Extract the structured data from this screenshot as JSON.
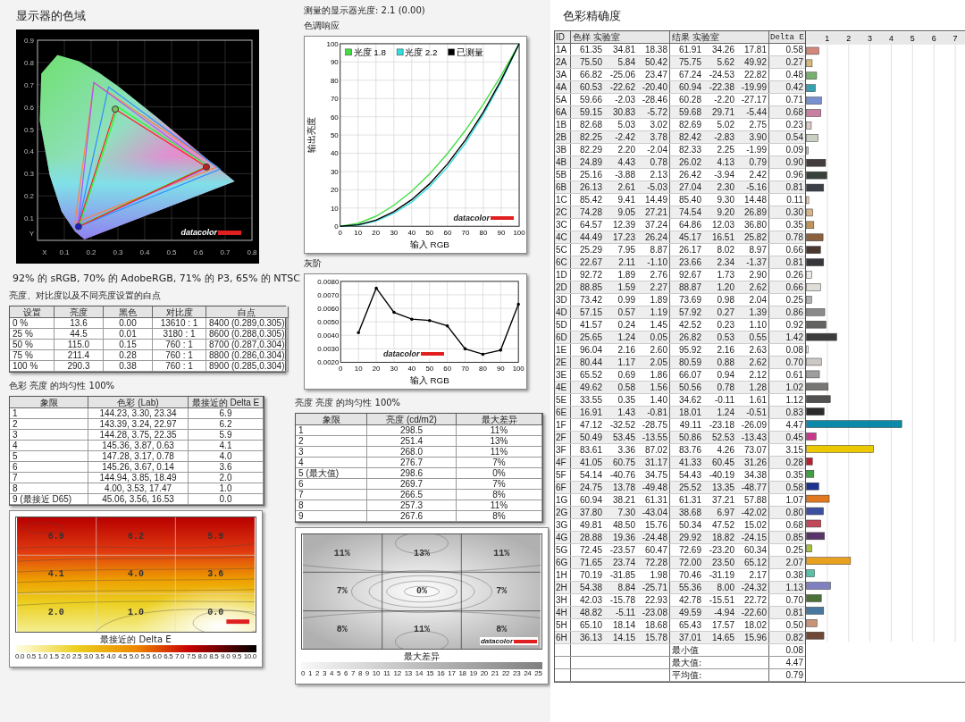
{
  "gamut": {
    "title": "显示器的色域",
    "x_ticks": [
      "X",
      "0.1",
      "0.2",
      "0.3",
      "0.4",
      "0.5",
      "0.6",
      "0.7",
      "0.8"
    ],
    "y_ticks": [
      "0.9",
      "0.8",
      "0.7",
      "0.6",
      "0.5",
      "0.4",
      "0.3",
      "0.2",
      "0.1",
      "Y"
    ],
    "brand": "datacolor",
    "summary": "92% 的 sRGB, 70% 的 AdobeRGB, 71% 的 P3, 65% 的 NTSC"
  },
  "brightness_table": {
    "title": "亮度、对比度以及不同亮度设置的白点",
    "columns": [
      "设置",
      "亮度",
      "黑色",
      "对比度",
      "白点"
    ],
    "rows": [
      [
        "0 %",
        "13.6",
        "0.00",
        "13610 : 1",
        "8400 (0.289,0.305)"
      ],
      [
        "25 %",
        "44.5",
        "0.01",
        "3180 : 1",
        "8600 (0.288,0.305)"
      ],
      [
        "50 %",
        "115.0",
        "0.15",
        "760 : 1",
        "8700 (0.287,0.304)"
      ],
      [
        "75 %",
        "211.4",
        "0.28",
        "760 : 1",
        "8800 (0.286,0.304)"
      ],
      [
        "100 %",
        "290.3",
        "0.38",
        "760 : 1",
        "8900 (0.285,0.304)"
      ]
    ]
  },
  "color_uniformity": {
    "title": "色彩 亮度 的均匀性 100%",
    "columns": [
      "象限",
      "色彩 (Lab)",
      "最接近的 Delta E"
    ],
    "rows": [
      [
        "1",
        "144.23, 3.30, 23.34",
        "6.9"
      ],
      [
        "2",
        "143.39, 3.24, 22.97",
        "6.2"
      ],
      [
        "3",
        "144.28, 3.75, 22.35",
        "5.9"
      ],
      [
        "4",
        "145.36, 3.87, 0.63",
        "4.1"
      ],
      [
        "5",
        "147.28, 3.17, 0.78",
        "4.0"
      ],
      [
        "6",
        "145.26, 3.67, 0.14",
        "3.6"
      ],
      [
        "7",
        "144.94, 3.85, 18.49",
        "2.0"
      ],
      [
        "8",
        "4.00, 3.53, 17.47",
        "1.0"
      ],
      [
        "9 (最接近 D65)",
        "45.06, 3.56, 16.53",
        "0.0"
      ]
    ],
    "heatmap": {
      "kind": "delta_e",
      "values": [
        "6.9",
        "6.2",
        "5.9",
        "4.1",
        "4.0",
        "3.6",
        "2.0",
        "1.0",
        "0.0"
      ],
      "legend_title": "最接近的 Delta E",
      "legend_ticks": [
        "0.0",
        "0.5",
        "1.0",
        "1.5",
        "2.0",
        "2.5",
        "3.0",
        "3.5",
        "4.0",
        "4.5",
        "5.0",
        "5.5",
        "6.0",
        "6.5",
        "7.0",
        "7.5",
        "8.0",
        "8.5",
        "9.0",
        "9.5",
        "10.0"
      ]
    }
  },
  "gamma": {
    "measured": "测量的显示器光度: 2.1 (0.00)",
    "title": "色调响应",
    "brand": "datacolor",
    "chart_data": {
      "type": "line",
      "grid": true,
      "legend": "upper left",
      "xlabel": "输入 RGB",
      "ylabel": "输出亮度",
      "x": [
        0,
        10,
        20,
        30,
        40,
        50,
        60,
        70,
        80,
        90,
        100
      ],
      "xlim": [
        0,
        100
      ],
      "ylim": [
        0,
        100
      ],
      "xticks": [
        0,
        10,
        20,
        30,
        40,
        50,
        60,
        70,
        80,
        90,
        100
      ],
      "yticks": [
        0,
        10,
        20,
        30,
        40,
        50,
        60,
        70,
        80,
        90,
        100
      ],
      "series": [
        {
          "name": "光度 1.8",
          "color": "#44dd44",
          "values": [
            0,
            1.6,
            5.5,
            11.5,
            19.2,
            28.7,
            39.9,
            52.6,
            66.9,
            82.7,
            100
          ]
        },
        {
          "name": "光度 2.2",
          "color": "#33dddd",
          "values": [
            0,
            0.6,
            2.9,
            7.1,
            13.3,
            21.8,
            32.5,
            45.6,
            61.2,
            79.3,
            100
          ]
        },
        {
          "name": "已测量",
          "color": "#000000",
          "values": [
            0,
            0.8,
            3.4,
            8.0,
            14.6,
            23.3,
            34.2,
            47.3,
            62.6,
            80.2,
            100
          ]
        }
      ]
    }
  },
  "grayscale": {
    "title": "灰阶",
    "brand": "datacolor",
    "chart_data": {
      "type": "line",
      "grid": true,
      "xlabel": "输入 RGB",
      "x": [
        10,
        20,
        30,
        40,
        50,
        60,
        70,
        80,
        90,
        100
      ],
      "xlim": [
        0,
        100
      ],
      "ylim": [
        0.002,
        0.008
      ],
      "xticks": [
        0,
        10,
        20,
        30,
        40,
        50,
        60,
        70,
        80,
        90,
        100
      ],
      "yticks": [
        {
          "value": 0.002,
          "label": "0.0020"
        },
        {
          "value": 0.003,
          "label": "0.0030"
        },
        {
          "value": 0.004,
          "label": "0.0040"
        },
        {
          "value": 0.005,
          "label": "0.0050"
        },
        {
          "value": 0.006,
          "label": "0.0060"
        },
        {
          "value": 0.007,
          "label": "0.0070"
        },
        {
          "value": 0.008,
          "label": "0.0080"
        }
      ],
      "series": [
        {
          "color": "#000000",
          "values": [
            0.0042,
            0.0075,
            0.0057,
            0.0052,
            0.0051,
            0.0047,
            0.003,
            0.0026,
            0.0029,
            0.0063
          ]
        }
      ]
    }
  },
  "luminance_uniformity": {
    "title": "亮度 亮度 的均匀性 100%",
    "columns": [
      "象限",
      "亮度 (cd/m2)",
      "最大差异"
    ],
    "rows": [
      [
        "1",
        "298.5",
        "11%"
      ],
      [
        "2",
        "251.4",
        "13%"
      ],
      [
        "3",
        "268.0",
        "11%"
      ],
      [
        "4",
        "276.7",
        "7%"
      ],
      [
        "5 (最大值)",
        "298.6",
        "0%"
      ],
      [
        "6",
        "269.7",
        "7%"
      ],
      [
        "7",
        "266.5",
        "8%"
      ],
      [
        "8",
        "257.3",
        "11%"
      ],
      [
        "9",
        "267.6",
        "8%"
      ]
    ],
    "heatmap": {
      "kind": "luminance",
      "values": [
        "11%",
        "13%",
        "11%",
        "7%",
        "0%",
        "7%",
        "8%",
        "11%",
        "8%"
      ],
      "legend_title": "最大差异",
      "brand": "datacolor",
      "legend_ticks": [
        "0",
        "1",
        "2",
        "3",
        "4",
        "5",
        "6",
        "7",
        "8",
        "9",
        "10",
        "11",
        "12",
        "13",
        "14",
        "15",
        "16",
        "17",
        "18",
        "19",
        "20",
        "21",
        "22",
        "23",
        "24",
        "25"
      ]
    }
  },
  "accuracy": {
    "title": "色彩精确度",
    "columns": [
      "ID",
      "色样 实验室",
      "结果 实验室",
      "Delta E"
    ],
    "rows": [
      {
        "id": "1A",
        "sample": [
          "61.35",
          "34.81",
          "18.38"
        ],
        "result": [
          "61.91",
          "34.26",
          "17.81"
        ],
        "delta_e": "0.58",
        "color": "#d4887c"
      },
      {
        "id": "2A",
        "sample": [
          "75.50",
          "5.84",
          "50.42"
        ],
        "result": [
          "75.75",
          "5.62",
          "49.92"
        ],
        "delta_e": "0.27",
        "color": "#d8b878"
      },
      {
        "id": "3A",
        "sample": [
          "66.82",
          "-25.06",
          "23.47"
        ],
        "result": [
          "67.24",
          "-24.53",
          "22.82"
        ],
        "delta_e": "0.48",
        "color": "#78b070"
      },
      {
        "id": "4A",
        "sample": [
          "60.53",
          "-22.62",
          "-20.40"
        ],
        "result": [
          "60.94",
          "-22.38",
          "-19.99"
        ],
        "delta_e": "0.42",
        "color": "#3aa0b0"
      },
      {
        "id": "5A",
        "sample": [
          "59.66",
          "-2.03",
          "-28.46"
        ],
        "result": [
          "60.28",
          "-2.20",
          "-27.17"
        ],
        "delta_e": "0.71",
        "color": "#7890d0"
      },
      {
        "id": "6A",
        "sample": [
          "59.15",
          "30.83",
          "-5.72"
        ],
        "result": [
          "59.68",
          "29.71",
          "-5.44"
        ],
        "delta_e": "0.68",
        "color": "#c880a0"
      },
      {
        "id": "1B",
        "sample": [
          "82.68",
          "5.03",
          "3.02"
        ],
        "result": [
          "82.69",
          "5.02",
          "2.75"
        ],
        "delta_e": "0.23",
        "color": "#dccbc6"
      },
      {
        "id": "2B",
        "sample": [
          "82.25",
          "-2.42",
          "3.78"
        ],
        "result": [
          "82.42",
          "-2.83",
          "3.90"
        ],
        "delta_e": "0.54",
        "color": "#c9d0c2"
      },
      {
        "id": "3B",
        "sample": [
          "82.29",
          "2.20",
          "-2.04"
        ],
        "result": [
          "82.33",
          "2.25",
          "-1.99"
        ],
        "delta_e": "0.09",
        "color": "#d0cbd0"
      },
      {
        "id": "4B",
        "sample": [
          "24.89",
          "4.43",
          "0.78"
        ],
        "result": [
          "26.02",
          "4.13",
          "0.79"
        ],
        "delta_e": "0.90",
        "color": "#443c3c"
      },
      {
        "id": "5B",
        "sample": [
          "25.16",
          "-3.88",
          "2.13"
        ],
        "result": [
          "26.42",
          "-3.94",
          "2.42"
        ],
        "delta_e": "0.96",
        "color": "#38403a"
      },
      {
        "id": "6B",
        "sample": [
          "26.13",
          "2.61",
          "-5.03"
        ],
        "result": [
          "27.04",
          "2.30",
          "-5.16"
        ],
        "delta_e": "0.81",
        "color": "#3c3e48"
      },
      {
        "id": "1C",
        "sample": [
          "85.42",
          "9.41",
          "14.49"
        ],
        "result": [
          "85.40",
          "9.30",
          "14.48"
        ],
        "delta_e": "0.11",
        "color": "#f0d0bc"
      },
      {
        "id": "2C",
        "sample": [
          "74.28",
          "9.05",
          "27.21"
        ],
        "result": [
          "74.54",
          "9.20",
          "26.89"
        ],
        "delta_e": "0.30",
        "color": "#d8b488"
      },
      {
        "id": "3C",
        "sample": [
          "64.57",
          "12.39",
          "37.24"
        ],
        "result": [
          "64.86",
          "12.03",
          "36.80"
        ],
        "delta_e": "0.35",
        "color": "#c09458"
      },
      {
        "id": "4C",
        "sample": [
          "44.49",
          "17.23",
          "26.24"
        ],
        "result": [
          "45.17",
          "16.51",
          "25.82"
        ],
        "delta_e": "0.78",
        "color": "#8a6040"
      },
      {
        "id": "5C",
        "sample": [
          "25.29",
          "7.95",
          "8.87"
        ],
        "result": [
          "26.17",
          "8.02",
          "8.97"
        ],
        "delta_e": "0.66",
        "color": "#4a3830"
      },
      {
        "id": "6C",
        "sample": [
          "22.67",
          "2.11",
          "-1.10"
        ],
        "result": [
          "23.66",
          "2.34",
          "-1.37"
        ],
        "delta_e": "0.81",
        "color": "#38363a"
      },
      {
        "id": "1D",
        "sample": [
          "92.72",
          "1.89",
          "2.76"
        ],
        "result": [
          "92.67",
          "1.73",
          "2.90"
        ],
        "delta_e": "0.26",
        "color": "#ece8e4"
      },
      {
        "id": "2D",
        "sample": [
          "88.85",
          "1.59",
          "2.27"
        ],
        "result": [
          "88.87",
          "1.20",
          "2.62"
        ],
        "delta_e": "0.66",
        "color": "#e0dcd8"
      },
      {
        "id": "3D",
        "sample": [
          "73.42",
          "0.99",
          "1.89"
        ],
        "result": [
          "73.69",
          "0.98",
          "2.04"
        ],
        "delta_e": "0.25",
        "color": "#b4b2b0"
      },
      {
        "id": "4D",
        "sample": [
          "57.15",
          "0.57",
          "1.19"
        ],
        "result": [
          "57.92",
          "0.27",
          "1.39"
        ],
        "delta_e": "0.86",
        "color": "#8a8a88"
      },
      {
        "id": "5D",
        "sample": [
          "41.57",
          "0.24",
          "1.45"
        ],
        "result": [
          "42.52",
          "0.23",
          "1.10"
        ],
        "delta_e": "0.92",
        "color": "#626260"
      },
      {
        "id": "6D",
        "sample": [
          "25.65",
          "1.24",
          "0.05"
        ],
        "result": [
          "26.82",
          "0.53",
          "0.55"
        ],
        "delta_e": "1.42",
        "color": "#3c3c3c"
      },
      {
        "id": "1E",
        "sample": [
          "96.04",
          "2.16",
          "2.60"
        ],
        "result": [
          "95.92",
          "2.16",
          "2.63"
        ],
        "delta_e": "0.08",
        "color": "#f6f2ee"
      },
      {
        "id": "2E",
        "sample": [
          "80.44",
          "1.17",
          "2.05"
        ],
        "result": [
          "80.59",
          "0.88",
          "2.62"
        ],
        "delta_e": "0.70",
        "color": "#ccc8c4"
      },
      {
        "id": "3E",
        "sample": [
          "65.52",
          "0.69",
          "1.86"
        ],
        "result": [
          "66.07",
          "0.94",
          "2.12"
        ],
        "delta_e": "0.61",
        "color": "#a09e9c"
      },
      {
        "id": "4E",
        "sample": [
          "49.62",
          "0.58",
          "1.56"
        ],
        "result": [
          "50.56",
          "0.78",
          "1.28"
        ],
        "delta_e": "1.02",
        "color": "#787674"
      },
      {
        "id": "5E",
        "sample": [
          "33.55",
          "0.35",
          "1.40"
        ],
        "result": [
          "34.62",
          "-0.11",
          "1.61"
        ],
        "delta_e": "1.12",
        "color": "#525150"
      },
      {
        "id": "6E",
        "sample": [
          "16.91",
          "1.43",
          "-0.81"
        ],
        "result": [
          "18.01",
          "1.24",
          "-0.51"
        ],
        "delta_e": "0.83",
        "color": "#2c2a2c"
      },
      {
        "id": "1F",
        "sample": [
          "47.12",
          "-32.52",
          "-28.75"
        ],
        "result": [
          "49.11",
          "-23.18",
          "-26.09"
        ],
        "delta_e": "4.47",
        "color": "#0a8aa8"
      },
      {
        "id": "2F",
        "sample": [
          "50.49",
          "53.45",
          "-13.55"
        ],
        "result": [
          "50.86",
          "52.53",
          "-13.43"
        ],
        "delta_e": "0.45",
        "color": "#c8388a"
      },
      {
        "id": "3F",
        "sample": [
          "83.61",
          "3.36",
          "87.02"
        ],
        "result": [
          "83.76",
          "4.26",
          "73.07"
        ],
        "delta_e": "3.15",
        "color": "#ecc800"
      },
      {
        "id": "4F",
        "sample": [
          "41.05",
          "60.75",
          "31.17"
        ],
        "result": [
          "41.33",
          "60.45",
          "31.26"
        ],
        "delta_e": "0.28",
        "color": "#b82030"
      },
      {
        "id": "5F",
        "sample": [
          "54.14",
          "-40.76",
          "34.75"
        ],
        "result": [
          "54.43",
          "-40.19",
          "34.38"
        ],
        "delta_e": "0.35",
        "color": "#40a040"
      },
      {
        "id": "6F",
        "sample": [
          "24.75",
          "13.78",
          "-49.48"
        ],
        "result": [
          "25.52",
          "13.35",
          "-48.77"
        ],
        "delta_e": "0.58",
        "color": "#1c3490"
      },
      {
        "id": "1G",
        "sample": [
          "60.94",
          "38.21",
          "61.31"
        ],
        "result": [
          "61.31",
          "37.21",
          "57.88"
        ],
        "delta_e": "1.07",
        "color": "#e07820"
      },
      {
        "id": "2G",
        "sample": [
          "37.80",
          "7.30",
          "-43.04"
        ],
        "result": [
          "38.68",
          "6.97",
          "-42.02"
        ],
        "delta_e": "0.80",
        "color": "#3c50a0"
      },
      {
        "id": "3G",
        "sample": [
          "49.81",
          "48.50",
          "15.76"
        ],
        "result": [
          "50.34",
          "47.52",
          "15.02"
        ],
        "delta_e": "0.68",
        "color": "#c04858"
      },
      {
        "id": "4G",
        "sample": [
          "28.88",
          "19.36",
          "-24.48"
        ],
        "result": [
          "29.92",
          "18.82",
          "-24.15"
        ],
        "delta_e": "0.85",
        "color": "#583468"
      },
      {
        "id": "5G",
        "sample": [
          "72.45",
          "-23.57",
          "60.47"
        ],
        "result": [
          "72.69",
          "-23.20",
          "60.34"
        ],
        "delta_e": "0.25",
        "color": "#a8c040"
      },
      {
        "id": "6G",
        "sample": [
          "71.65",
          "23.74",
          "72.28"
        ],
        "result": [
          "72.00",
          "23.50",
          "65.12"
        ],
        "delta_e": "2.07",
        "color": "#e8a020"
      },
      {
        "id": "1H",
        "sample": [
          "70.19",
          "-31.85",
          "1.98"
        ],
        "result": [
          "70.46",
          "-31.19",
          "2.17"
        ],
        "delta_e": "0.38",
        "color": "#58c0a8"
      },
      {
        "id": "2H",
        "sample": [
          "54.38",
          "8.84",
          "-25.71"
        ],
        "result": [
          "55.36",
          "8.00",
          "-24.32"
        ],
        "delta_e": "1.13",
        "color": "#8080c0"
      },
      {
        "id": "3H",
        "sample": [
          "42.03",
          "-15.78",
          "22.93"
        ],
        "result": [
          "42.78",
          "-15.51",
          "22.72"
        ],
        "delta_e": "0.70",
        "color": "#4c7038"
      },
      {
        "id": "4H",
        "sample": [
          "48.82",
          "-5.11",
          "-23.08"
        ],
        "result": [
          "49.59",
          "-4.94",
          "-22.60"
        ],
        "delta_e": "0.81",
        "color": "#4878a0"
      },
      {
        "id": "5H",
        "sample": [
          "65.10",
          "18.14",
          "18.68"
        ],
        "result": [
          "65.43",
          "17.57",
          "18.02"
        ],
        "delta_e": "0.50",
        "color": "#c89478"
      },
      {
        "id": "6H",
        "sample": [
          "36.13",
          "14.15",
          "15.78"
        ],
        "result": [
          "37.01",
          "14.65",
          "15.96"
        ],
        "delta_e": "0.82",
        "color": "#704838"
      }
    ],
    "summary": [
      {
        "label": "最小值",
        "value": "0.08"
      },
      {
        "label": "最大值:",
        "value": "4.47"
      },
      {
        "label": "平均值:",
        "value": "0.79"
      }
    ],
    "chart_data": {
      "type": "bar",
      "orientation": "horizontal",
      "grid": true,
      "xticks": [
        1,
        2,
        3,
        4,
        5,
        6,
        7
      ],
      "xlim": [
        0,
        7.5
      ],
      "series": [
        {
          "values": [
            0.58,
            0.27,
            0.48,
            0.42,
            0.71,
            0.68,
            0.23,
            0.54,
            0.09,
            0.9,
            0.96,
            0.81,
            0.11,
            0.3,
            0.35,
            0.78,
            0.66,
            0.81,
            0.26,
            0.66,
            0.25,
            0.86,
            0.92,
            1.42,
            0.08,
            0.7,
            0.61,
            1.02,
            1.12,
            0.83,
            4.47,
            0.45,
            3.15,
            0.28,
            0.35,
            0.58,
            1.07,
            0.8,
            0.68,
            0.85,
            0.25,
            2.07,
            0.38,
            1.13,
            0.7,
            0.81,
            0.5,
            0.82
          ]
        }
      ]
    }
  }
}
